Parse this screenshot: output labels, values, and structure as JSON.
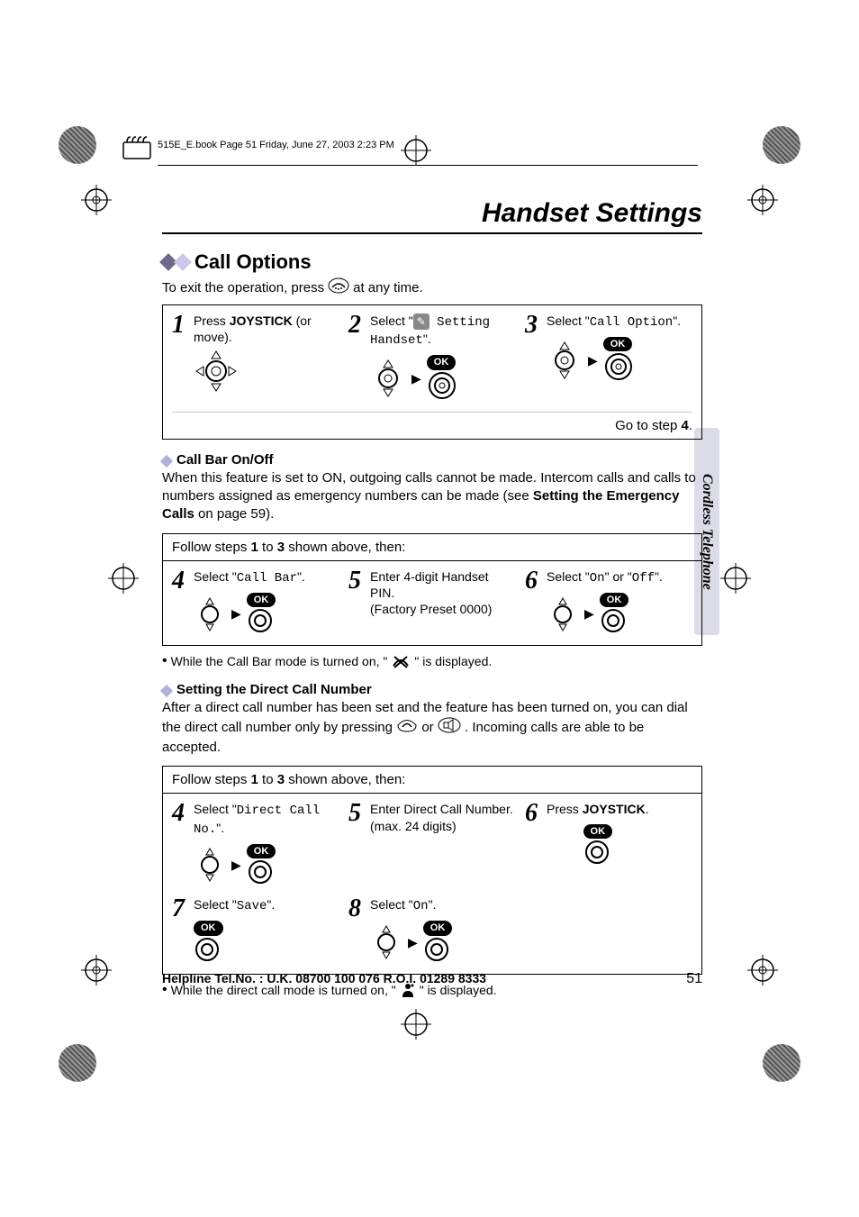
{
  "header_band": "515E_E.book  Page 51  Friday, June 27, 2003  2:23 PM",
  "section_title": "Handset Settings",
  "call_options_title": "Call Options",
  "exit_prefix": "To exit the operation, press ",
  "exit_suffix": " at any time.",
  "cancel_icon_name": "cancel-handset-icon",
  "intro_steps": {
    "s1": {
      "num": "1",
      "text_a": "Press ",
      "bold": "JOYSTICK",
      "text_b": " (or move)."
    },
    "s2": {
      "num": "2",
      "text_a": "Select \"",
      "mono": " Setting Handset",
      "text_b": "\"."
    },
    "s3": {
      "num": "3",
      "text_a": "Select \"",
      "mono": "Call Option",
      "text_b": "\"."
    },
    "go": "Go to step ",
    "go_bold": "4",
    "go_dot": "."
  },
  "ok_label": "OK",
  "callbar": {
    "heading": "Call Bar On/Off",
    "para_a": "When this feature is set to ON, outgoing calls cannot be made. Intercom calls and calls to numbers assigned as emergency numbers can be made (see ",
    "para_bold": "Setting the Emergency Calls",
    "para_b": " on page 59).",
    "follow_a": "Follow steps ",
    "follow_b1": "1",
    "follow_mid": " to ",
    "follow_b3": "3",
    "follow_c": " shown above, then:",
    "s4": {
      "num": "4",
      "text_a": "Select \"",
      "mono": "Call Bar",
      "text_b": "\"."
    },
    "s5": {
      "num": "5",
      "text": "Enter 4-digit Handset PIN.",
      "sub": "(Factory Preset 0000)"
    },
    "s6": {
      "num": "6",
      "text_a": "Select \"",
      "mono1": "On",
      "mid": "\" or \"",
      "mono2": "Off",
      "text_b": "\"."
    },
    "note_a": "While the Call Bar mode is turned on, \"",
    "note_b": "\" is displayed."
  },
  "direct": {
    "heading": "Setting the Direct Call Number",
    "para_a": "After a direct call number has been set and the feature has been turned on, you can dial the direct call number only by pressing ",
    "para_mid": " or ",
    "para_b": ". Incoming calls are able to be accepted.",
    "follow_a": "Follow steps ",
    "follow_b1": "1",
    "follow_mid": " to ",
    "follow_b3": "3",
    "follow_c": " shown above, then:",
    "s4": {
      "num": "4",
      "text_a": "Select \"",
      "mono": "Direct Call No.",
      "text_b": "\"."
    },
    "s5": {
      "num": "5",
      "text": "Enter Direct Call Number.",
      "sub": "(max. 24 digits)"
    },
    "s6": {
      "num": "6",
      "text_a": "Press ",
      "bold": "JOYSTICK",
      "text_b": "."
    },
    "s7": {
      "num": "7",
      "text_a": "Select \"",
      "mono": "Save",
      "text_b": "\"."
    },
    "s8": {
      "num": "8",
      "text_a": "Select \"",
      "mono": "On",
      "text_b": "\"."
    },
    "note_a": "While the direct call mode is turned on, \"",
    "note_b": "\" is displayed."
  },
  "side_tab": "Cordless Telephone",
  "footer_help": "Helpline Tel.No. : U.K. 08700 100 076  R.O.I. 01289 8333",
  "page_number": "51"
}
